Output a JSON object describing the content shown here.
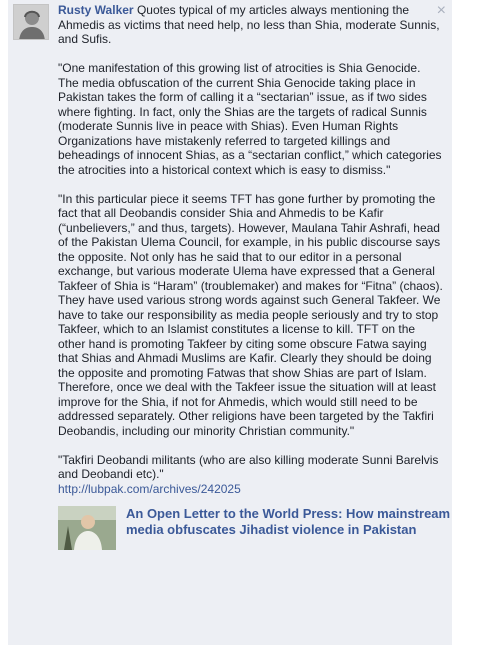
{
  "comment": {
    "author": "Rusty Walker",
    "intro": "Quotes typical of my articles always mentioning the Ahmedis as victims that need help, no less than Shia, moderate Sunnis, and Sufis.",
    "paragraphs": [
      "\"One manifestation of this growing list of atrocities is Shia Genocide. The media obfuscation of the current Shia Genocide taking place in Pakistan takes the form of calling it a “sectarian” issue, as if two sides where fighting. In fact, only the Shias are the targets of radical Sunnis (moderate Sunnis live in peace with Shias). Even Human Rights Organizations have mistakenly referred to targeted killings and beheadings of innocent Shias, as a “sectarian conflict,” which categories the atrocities into a historical context which is easy to dismiss.\"",
      "\"In this particular piece it seems TFT has gone further by promoting the fact that all Deobandis consider Shia and Ahmedis to be Kafir (“unbelievers,” and thus, targets). However, Maulana Tahir Ashrafi, head of the Pakistan Ulema Council, for example, in his public discourse says the opposite. Not only has he said that to our editor in a personal exchange, but various moderate Ulema have expressed that a General Takfeer of Shia is “Haram” (troublemaker) and makes for “Fitna” (chaos). They have used various strong words against such General Takfeer. We have to take our responsibility as media people seriously and try to stop Takfeer, which to an Islamist constitutes a license to kill. TFT on the other hand is promoting Takfeer by citing some obscure Fatwa saying that Shias and Ahmadi Muslims are Kafir. Clearly they should be doing the opposite and promoting Fatwas that show Shias are part of Islam. Therefore, once we deal with the Takfeer issue the situation will at least improve for the Shia, if not for Ahmedis, which would still need to be addressed separately. Other religions have been targeted by the Takfiri Deobandis, including our minority Christian community.\"",
      "\"Takfiri Deobandi militants (who are also killing moderate Sunni Barelvis and Deobandi etc).\""
    ],
    "link_text": "http://lubpak.com/archives/242025",
    "close_label": "×"
  },
  "attachment": {
    "title": "An Open Letter to the World Press: How mainstream media obfuscates Jihadist violence in Pakistan"
  }
}
